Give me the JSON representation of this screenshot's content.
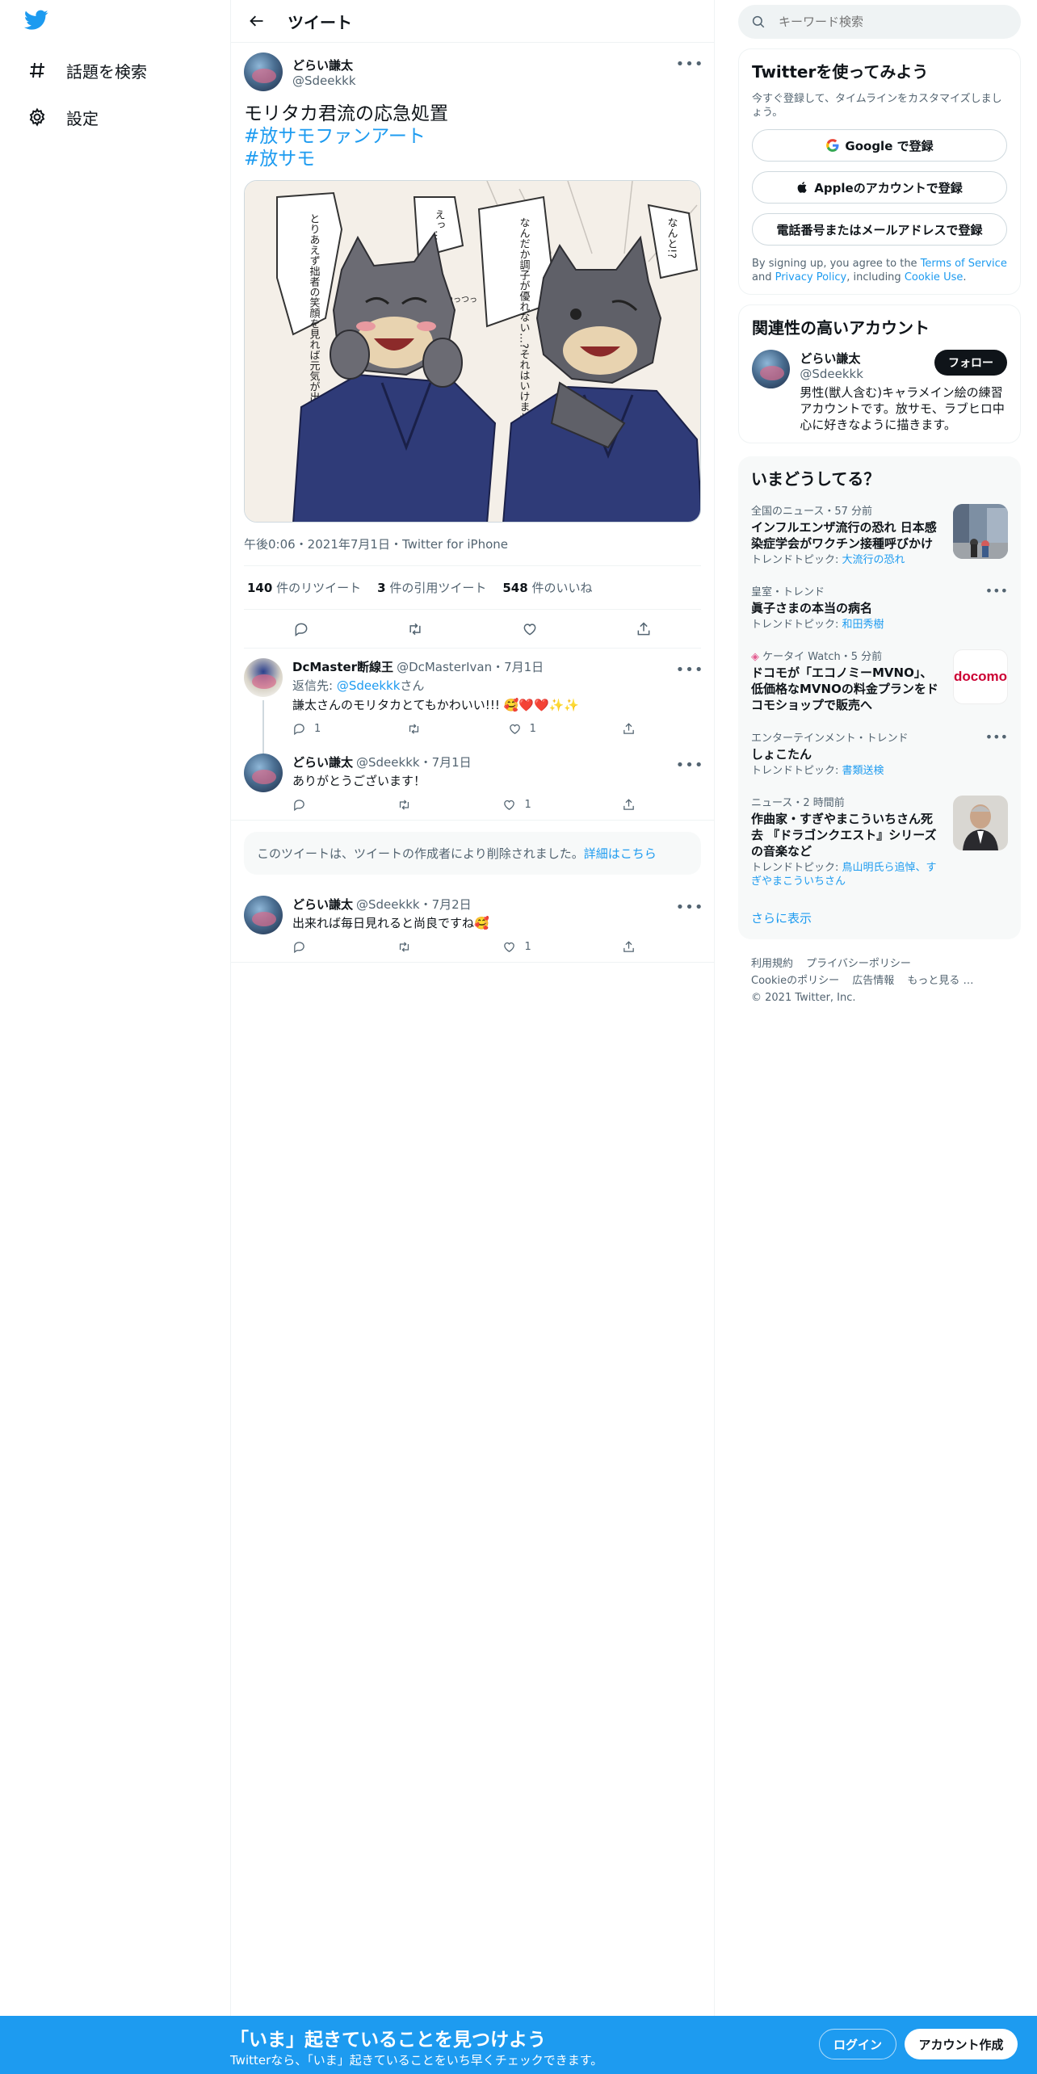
{
  "nav": {
    "items": [
      {
        "label": "話題を検索",
        "icon": "hashtag-icon"
      },
      {
        "label": "設定",
        "icon": "gear-icon"
      }
    ]
  },
  "header": {
    "title": "ツイート"
  },
  "tweet": {
    "display_name": "どらい謙太",
    "handle": "@Sdeekkk",
    "text": "モリタカ君流の応急処置",
    "hashtags": [
      "#放サモファンアート",
      "#放サモ"
    ],
    "meta": "午後0:06・2021年7月1日・Twitter for iPhone",
    "stats": {
      "retweets_count": "140",
      "retweets_label": "件のリツイート",
      "quotes_count": "3",
      "quotes_label": "件の引用ツイート",
      "likes_count": "548",
      "likes_label": "件のいいね"
    },
    "image_texts": [
      "とりあえず拙者の笑顔を見れば元気が出るでござる!!",
      "えっ…",
      "なんだか調子が優れない…?それはいけませぬ!!",
      "なんと!?",
      "つっつっ"
    ]
  },
  "replies": [
    {
      "display_name": "DcMaster断線王",
      "handle": "@DcMasterIvan",
      "date": "・7月1日",
      "reply_to_prefix": "返信先: ",
      "reply_to": "@Sdeekkk",
      "reply_to_suffix": "さん",
      "text": "謙太さんのモリタカとてもかわいい!!! 🥰❤️❤️✨✨",
      "reply_count": "1",
      "like_count": "1"
    },
    {
      "display_name": "どらい謙太",
      "handle": "@Sdeekkk",
      "date": "・7月1日",
      "text": "ありがとうございます！",
      "reply_count": "",
      "like_count": "1"
    },
    {
      "display_name": "どらい謙太",
      "handle": "@Sdeekkk",
      "date": "・7月2日",
      "text": "出来れば毎日見れると尚良ですね🥰",
      "reply_count": "",
      "like_count": "1"
    }
  ],
  "deleted_notice": {
    "text": "このツイートは、ツイートの作成者により削除されました。",
    "link": "詳細はこちら"
  },
  "search": {
    "placeholder": "キーワード検索"
  },
  "signup_card": {
    "title": "Twitterを使ってみよう",
    "subtitle": "今すぐ登録して、タイムラインをカスタマイズしましょう。",
    "google": "Google で登録",
    "apple": "Appleのアカウントで登録",
    "phone": "電話番号またはメールアドレスで登録",
    "terms_prefix": "By signing up, you agree to the ",
    "terms_link": "Terms of Service",
    "terms_and": " and ",
    "privacy_link": "Privacy Policy",
    "including": ", including ",
    "cookie_link": "Cookie Use",
    "period": "."
  },
  "related": {
    "title": "関連性の高いアカウント",
    "name": "どらい謙太",
    "handle": "@Sdeekkk",
    "follow": "フォロー",
    "bio": "男性(獣人含む)キャラメイン絵の練習アカウントです。放サモ、ラブヒロ中心に好きなように描きます。"
  },
  "trends": {
    "title": "いまどうしてる？",
    "items": [
      {
        "meta": "全国のニュース・57 分前",
        "title": "インフルエンザ流行の恐れ 日本感染症学会がワクチン接種呼びかけ",
        "topic_prefix": "トレンドトピック: ",
        "topic": "大流行の恐れ",
        "thumb": "photo-street"
      },
      {
        "meta": "皇室・トレンド",
        "title": "眞子さまの本当の病名",
        "topic_prefix": "トレンドトピック: ",
        "topic": "和田秀樹",
        "thumb": ""
      },
      {
        "meta": "ケータイ Watch・5 分前",
        "title": "ドコモが「エコノミーMVNO」、低価格なMVNOの料金プランをドコモショップで販売へ",
        "topic_prefix": "",
        "topic": "",
        "thumb": "docomo",
        "thumb_text": "docomo"
      },
      {
        "meta": "エンターテインメント・トレンド",
        "title": "しょこたん",
        "topic_prefix": "トレンドトピック: ",
        "topic": "書類送検",
        "thumb": ""
      },
      {
        "meta": "ニュース・2 時間前",
        "title": "作曲家・すぎやまこういちさん死去 『ドラゴンクエスト』シリーズの音楽など",
        "topic_prefix": "トレンドトピック: ",
        "topic": "鳥山明氏ら追悼、すぎやまこういちさん",
        "thumb": "portrait"
      }
    ],
    "show_more": "さらに表示"
  },
  "footer": {
    "links": [
      "利用規約",
      "プライバシーポリシー",
      "Cookieのポリシー",
      "広告情報",
      "もっと見る …"
    ],
    "copyright": "© 2021 Twitter, Inc."
  },
  "bottom_bar": {
    "title": "「いま」起きていることを見つけよう",
    "subtitle": "Twitterなら、「いま」起きていることをいち早くチェックできます。",
    "login": "ログイン",
    "signup": "アカウント作成"
  },
  "colors": {
    "accent": "#1d9bf0",
    "text": "#0f1419",
    "muted": "#536471",
    "border": "#eff3f4"
  }
}
